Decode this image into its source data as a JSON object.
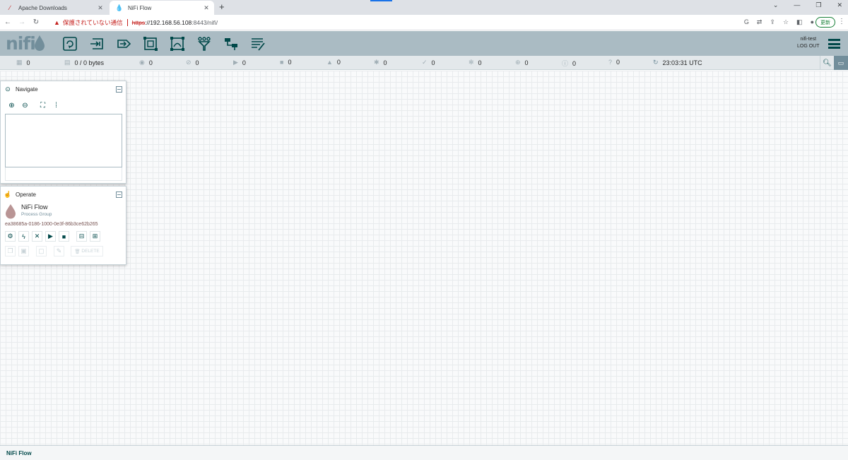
{
  "browser": {
    "tabs": [
      {
        "title": "Apache Downloads",
        "favicon": "apache-feather-icon",
        "active": false
      },
      {
        "title": "NiFi Flow",
        "favicon": "nifi-drop-icon",
        "active": true
      }
    ],
    "address": {
      "security_text": "保護されていない通信",
      "scheme": "https",
      "host": "://192.168.56.108",
      "path": ":8443/nifi/"
    },
    "update_label": "更新"
  },
  "header": {
    "logo_text": "nifi",
    "tools": [
      {
        "name": "processor"
      },
      {
        "name": "input-port"
      },
      {
        "name": "output-port"
      },
      {
        "name": "process-group"
      },
      {
        "name": "remote-process-group"
      },
      {
        "name": "funnel"
      },
      {
        "name": "template"
      },
      {
        "name": "label"
      }
    ],
    "user": {
      "name": "nifi-test",
      "logout_label": "LOG OUT"
    }
  },
  "status": {
    "active_threads": "0",
    "queued": "0 / 0 bytes",
    "transmitting": "0",
    "not_transmitting": "0",
    "running": "0",
    "stopped": "0",
    "invalid": "0",
    "disabled": "0",
    "up_to_date": "0",
    "locally_modified": "0",
    "stale": "0",
    "locally_modified_stale": "0",
    "sync_failure": "0",
    "last_refreshed": "23:03:31 UTC"
  },
  "navigate": {
    "title": "Navigate"
  },
  "operate": {
    "title": "Operate",
    "pg_name": "NiFi Flow",
    "pg_type": "Process Group",
    "pg_id": "ea38685a-0186-1000-0e3f-86b3ce62b265",
    "delete_label": "DELETE"
  },
  "breadcrumb": {
    "current": "NiFi Flow"
  },
  "colors": {
    "header_bg": "#aabbc3",
    "primary": "#004849",
    "status_bg": "#e3e8eb"
  }
}
